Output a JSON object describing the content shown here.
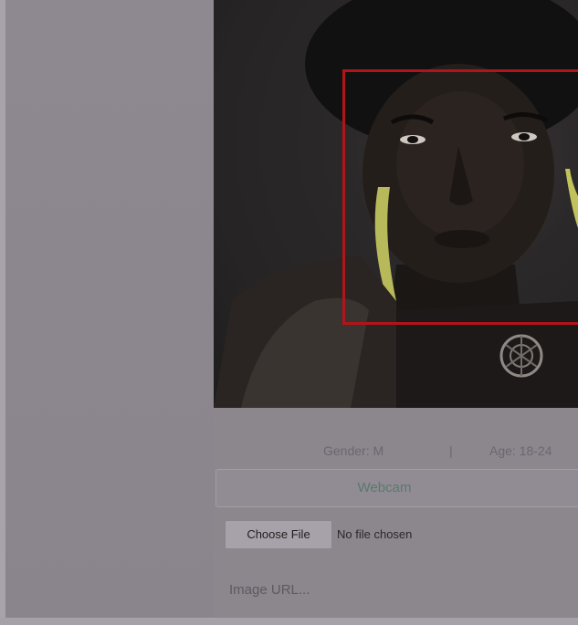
{
  "result": {
    "gender_text": "Gender: M",
    "separator": "|",
    "age_text": "Age: 18-24"
  },
  "controls": {
    "webcam_label": "Webcam",
    "choose_file_label": "Choose File",
    "file_status": "No file chosen",
    "url_placeholder": "Image URL..."
  },
  "colors": {
    "face_box": "#b2141a",
    "background": "#8c868d"
  }
}
